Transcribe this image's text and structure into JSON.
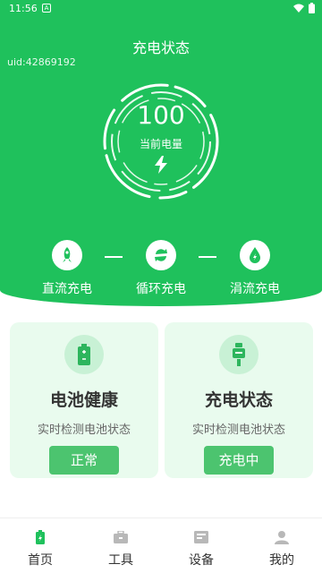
{
  "status_bar": {
    "time": "11:56",
    "notification_icon": "A"
  },
  "header": {
    "title": "充电状态",
    "uid": "uid:42869192"
  },
  "gauge": {
    "value": "100",
    "label": "当前电量"
  },
  "modes": [
    {
      "label": "直流充电",
      "icon": "rocket-icon"
    },
    {
      "label": "循环充电",
      "icon": "cycle-icon"
    },
    {
      "label": "涓流充电",
      "icon": "drop-icon"
    }
  ],
  "cards": [
    {
      "title": "电池健康",
      "subtitle": "实时检测电池状态",
      "button": "正常",
      "icon": "battery-icon"
    },
    {
      "title": "充电状态",
      "subtitle": "实时检测电池状态",
      "button": "充电中",
      "icon": "charger-icon"
    }
  ],
  "tabs": [
    {
      "label": "首页",
      "icon": "home-icon"
    },
    {
      "label": "工具",
      "icon": "toolbox-icon"
    },
    {
      "label": "设备",
      "icon": "device-icon"
    },
    {
      "label": "我的",
      "icon": "profile-icon"
    }
  ],
  "colors": {
    "primary": "#1fc15c",
    "card_bg": "#e9fbee",
    "button": "#4cc46f",
    "active_tab": "#1fc15c",
    "inactive_tab": "#b8b8b8"
  }
}
